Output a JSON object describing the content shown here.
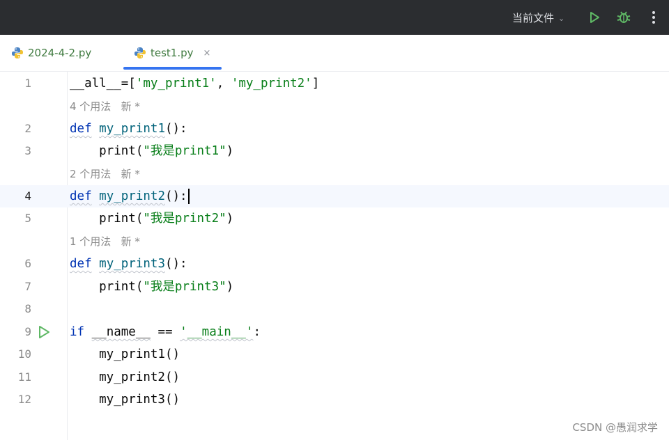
{
  "toolbar": {
    "run_config_label": "当前文件",
    "run_icon": "play-icon",
    "debug_icon": "bug-icon",
    "more_icon": "more-vertical-icon",
    "accent_green": "#5fb865",
    "background": "#2b2d30"
  },
  "tabs": [
    {
      "label": "2024-4-2.py",
      "icon": "python-icon",
      "active": false
    },
    {
      "label": "test1.py",
      "icon": "python-icon",
      "active": true,
      "close_glyph": "×"
    }
  ],
  "editor": {
    "lines": [
      {
        "number": "1",
        "text": "__all__=['my_print1', 'my_print2']"
      },
      {
        "hint": "4 个用法   新 *"
      },
      {
        "number": "2",
        "text": "def my_print1():"
      },
      {
        "number": "3",
        "text": "    print(\"我是print1\")"
      },
      {
        "hint": "2 个用法   新 *"
      },
      {
        "number": "4",
        "text": "def my_print2():"
      },
      {
        "number": "5",
        "text": "    print(\"我是print2\")"
      },
      {
        "hint": "1 个用法   新 *"
      },
      {
        "number": "6",
        "text": "def my_print3():"
      },
      {
        "number": "7",
        "text": "    print(\"我是print3\")"
      },
      {
        "number": "8",
        "text": ""
      },
      {
        "number": "9",
        "text": "if __name__ == '__main__':"
      },
      {
        "number": "10",
        "text": "    my_print1()"
      },
      {
        "number": "11",
        "text": "    my_print2()"
      },
      {
        "number": "12",
        "text": "    my_print3()"
      }
    ],
    "current_line": "4"
  },
  "watermark": "CSDN @愚润求学"
}
